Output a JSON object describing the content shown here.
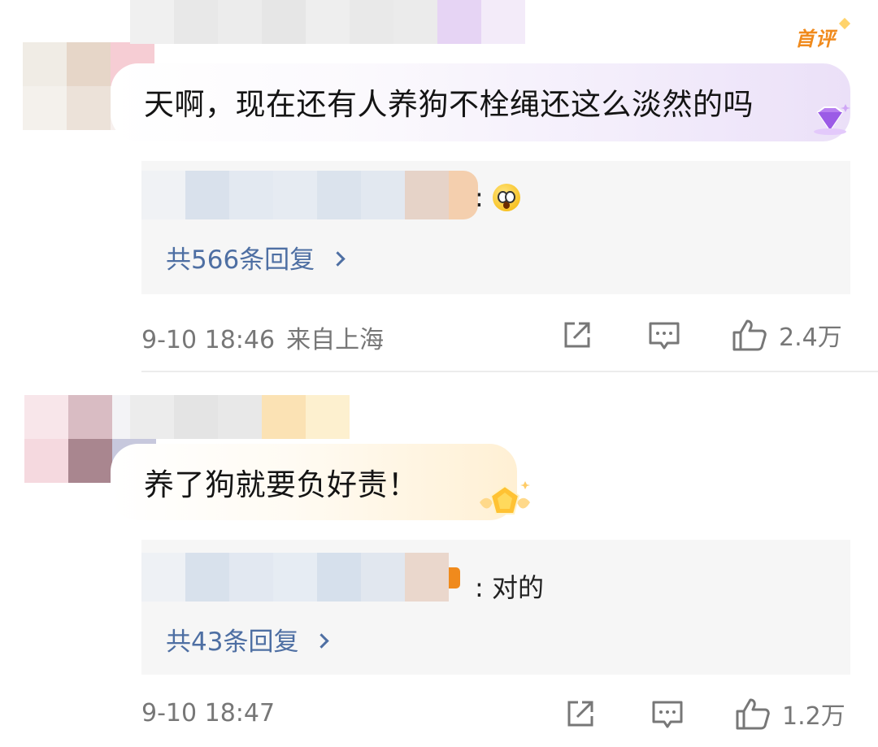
{
  "comments": [
    {
      "badge": "首评",
      "text": "天啊，现在还有人养狗不栓绳还这么淡然的吗",
      "reply_preview": ":",
      "reply_count": "共566条回复",
      "time": "9-10 18:46",
      "location": "来自上海",
      "likes": "2.4万",
      "gem_icon": "purple-diamond-icon",
      "reply_emoji": "shocked-face-emoji"
    },
    {
      "text": "养了狗就要负好责！",
      "reply_preview": ": 对的",
      "reply_count": "共43条回复",
      "time": "9-10 18:47",
      "location": "",
      "likes": "1.2万",
      "gem_icon": "gold-gem-icon"
    }
  ],
  "colors": {
    "link_blue": "#4e6fa3",
    "meta_gray": "#777777",
    "badge_orange": "#f08a1c",
    "reply_bg": "#f6f6f6"
  }
}
